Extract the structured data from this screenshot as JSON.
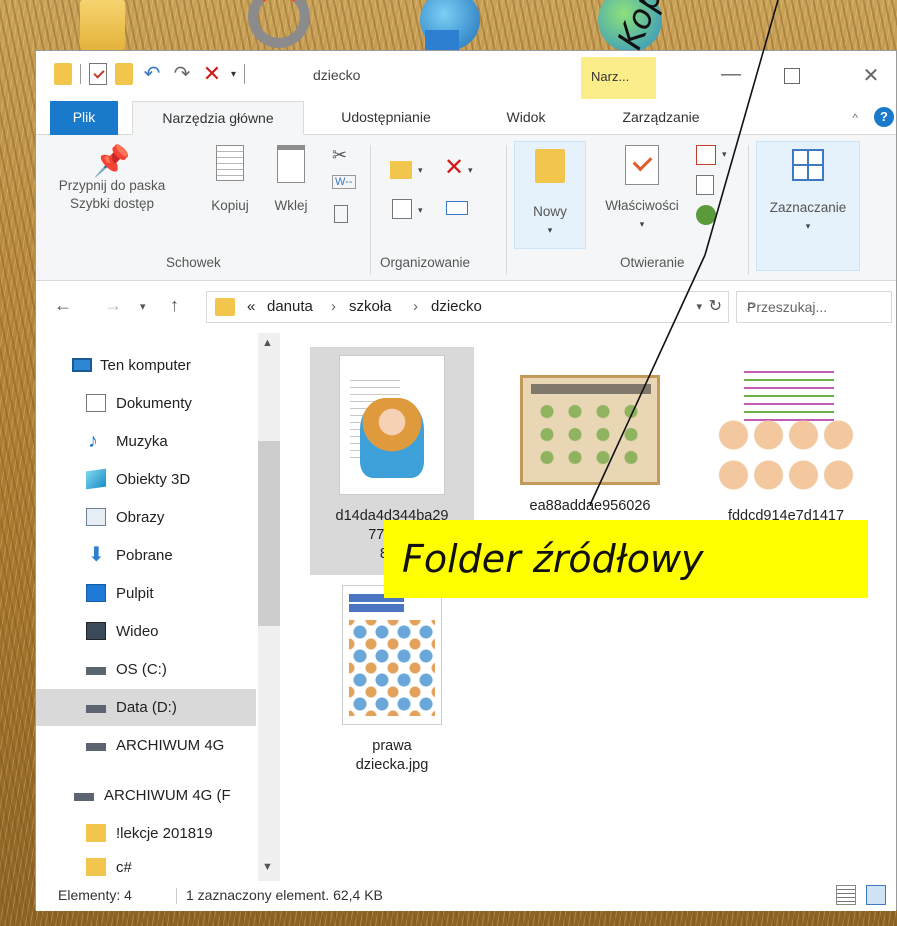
{
  "window": {
    "title": "dziecko",
    "context_tool_label": "Narz..."
  },
  "ribbon_tabs": {
    "file": "Plik",
    "home": "Narzędzia główne",
    "share": "Udostępnianie",
    "view": "Widok",
    "manage": "Zarządzanie"
  },
  "ribbon": {
    "pin_label_line1": "Przypnij do paska",
    "pin_label_line2": "Szybki dostęp",
    "copy_label": "Kopiuj",
    "paste_label": "Wklej",
    "new_label": "Nowy",
    "properties_label": "Właściwości",
    "select_label": "Zaznaczanie",
    "group_clipboard": "Schowek",
    "group_organize": "Organizowanie",
    "group_open": "Otwieranie"
  },
  "address": {
    "prefix": "«",
    "crumbs": [
      "danuta",
      "szkoła",
      "dziecko"
    ],
    "separator": "›",
    "search_placeholder": "Przeszukaj..."
  },
  "nav_pane": {
    "items": [
      {
        "label": "Ten komputer",
        "icon": "computer-icon"
      },
      {
        "label": "Dokumenty",
        "icon": "documents-icon"
      },
      {
        "label": "Muzyka",
        "icon": "music-icon"
      },
      {
        "label": "Obiekty 3D",
        "icon": "3d-objects-icon"
      },
      {
        "label": "Obrazy",
        "icon": "pictures-icon"
      },
      {
        "label": "Pobrane",
        "icon": "downloads-icon"
      },
      {
        "label": "Pulpit",
        "icon": "desktop-icon"
      },
      {
        "label": "Wideo",
        "icon": "video-icon"
      },
      {
        "label": "OS (C:)",
        "icon": "os-drive-icon"
      },
      {
        "label": "Data (D:)",
        "icon": "drive-icon",
        "selected": true
      },
      {
        "label": "ARCHIWUM 4G",
        "icon": "drive-icon"
      },
      {
        "label": "ARCHIWUM 4G (F",
        "icon": "drive-icon"
      },
      {
        "label": "!lekcje 201819",
        "icon": "folder-icon"
      },
      {
        "label": "c#",
        "icon": "folder-icon"
      }
    ]
  },
  "files": [
    {
      "line1": "d14da4d344ba29",
      "line2": "77cd26",
      "line3": "801",
      "selected": true
    },
    {
      "line1": "ea88addae956026"
    },
    {
      "line1": "fddcd914e7d1417"
    },
    {
      "line1": "prawa",
      "line2": "dziecka.jpg"
    }
  ],
  "status": {
    "count": "Elementy: 4",
    "selection": "1 zaznaczony element. 62,4 KB"
  },
  "annotations": {
    "source_folder": "Folder źródłowy",
    "copying": "Kopiowanie"
  },
  "colors": {
    "accent": "#1979ca",
    "highlight_label": "#ffff00",
    "context_tool": "#fbee8a"
  }
}
